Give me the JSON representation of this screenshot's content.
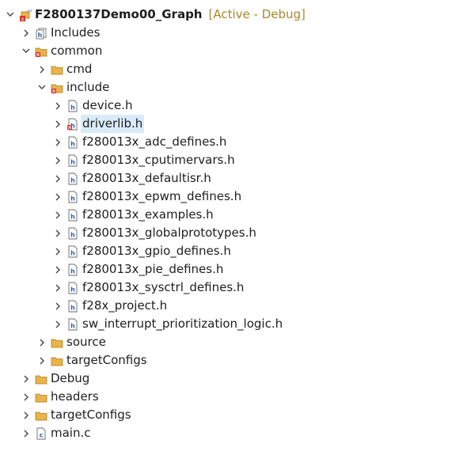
{
  "project": {
    "name": "F2800137Demo00_Graph",
    "status": "[Active - Debug]"
  },
  "tree": {
    "includes": "Includes",
    "common": "common",
    "cmd": "cmd",
    "include": "include",
    "files": [
      "device.h",
      "driverlib.h",
      "f280013x_adc_defines.h",
      "f280013x_cputimervars.h",
      "f280013x_defaultisr.h",
      "f280013x_epwm_defines.h",
      "f280013x_examples.h",
      "f280013x_globalprototypes.h",
      "f280013x_gpio_defines.h",
      "f280013x_pie_defines.h",
      "f280013x_sysctrl_defines.h",
      "f28x_project.h",
      "sw_interrupt_prioritization_logic.h"
    ],
    "source": "source",
    "target_configs_inner": "targetConfigs",
    "debug": "Debug",
    "headers": "headers",
    "target_configs": "targetConfigs",
    "main": "main.c"
  },
  "colors": {
    "status": "#a6882a",
    "folder": "#e8b54a",
    "error_badge": "#d9342b",
    "selection": "#d9ebf9"
  },
  "icons": {
    "expanded": "chevron-down-icon",
    "collapsed": "chevron-right-icon",
    "folder": "folder-icon",
    "header_file": "header-file-icon",
    "c_file": "c-file-icon",
    "project": "ccs-project-icon"
  }
}
